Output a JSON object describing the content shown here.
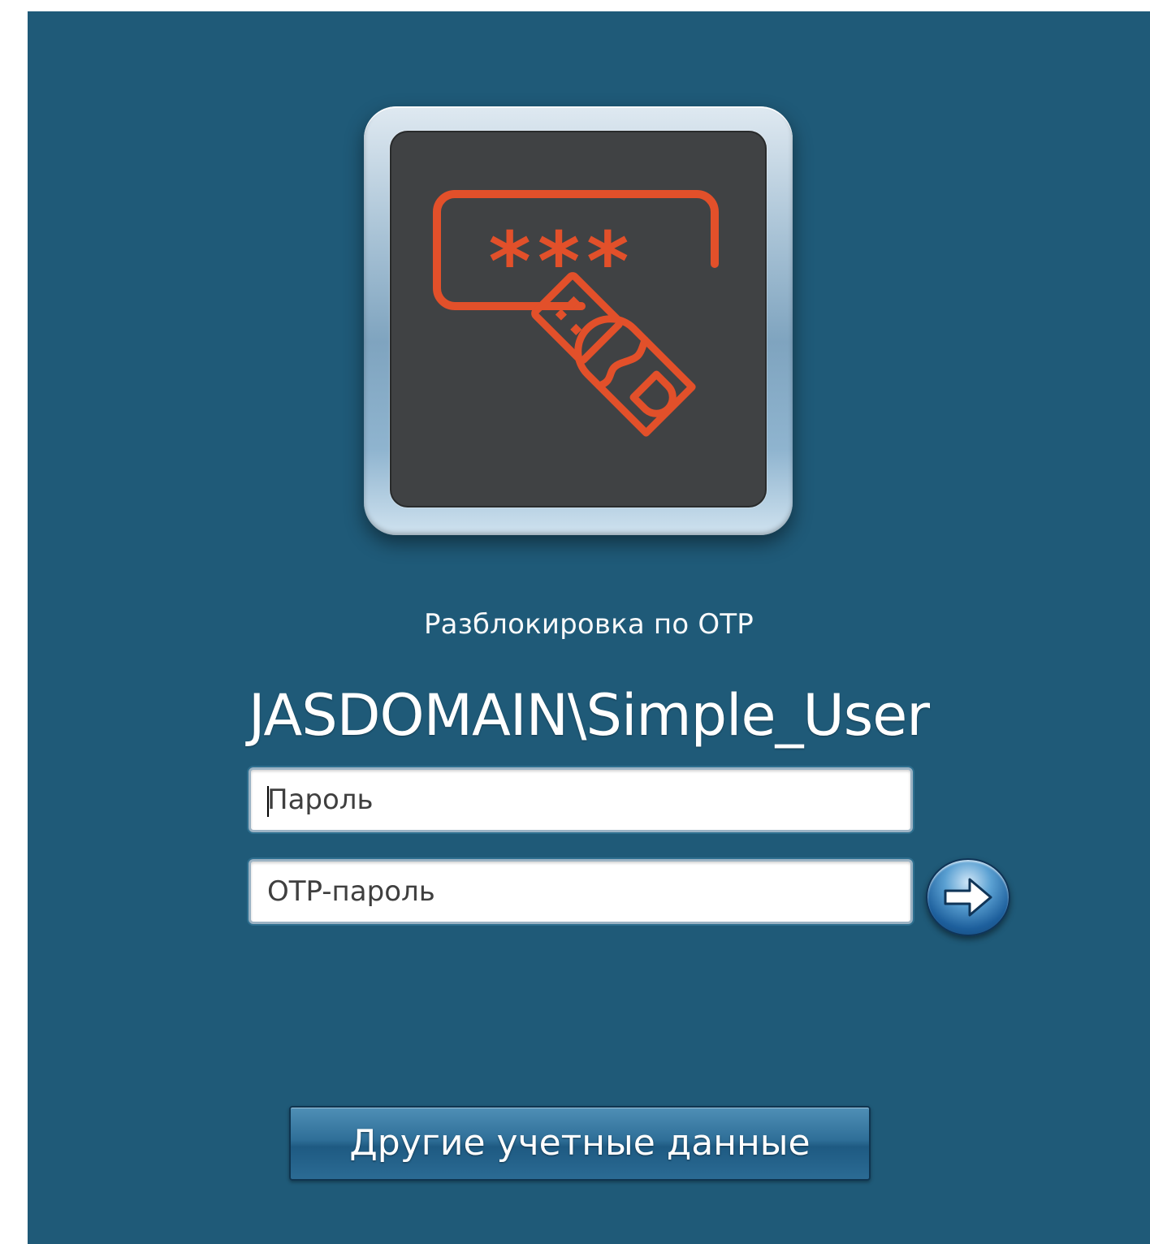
{
  "colors": {
    "background": "#1f5a78",
    "accent_icon": "#e2502a",
    "tile_background": "#404244"
  },
  "tile": {
    "icon": "otp-token-icon",
    "stars": "***"
  },
  "subtitle": "Разблокировка по OTP",
  "username": "JASDOMAIN\\Simple_User",
  "fields": {
    "password_placeholder": "Пароль",
    "otp_placeholder": "OTP-пароль"
  },
  "go_button": {
    "icon": "arrow-right-icon"
  },
  "switch_user_button": "Другие учетные данные"
}
